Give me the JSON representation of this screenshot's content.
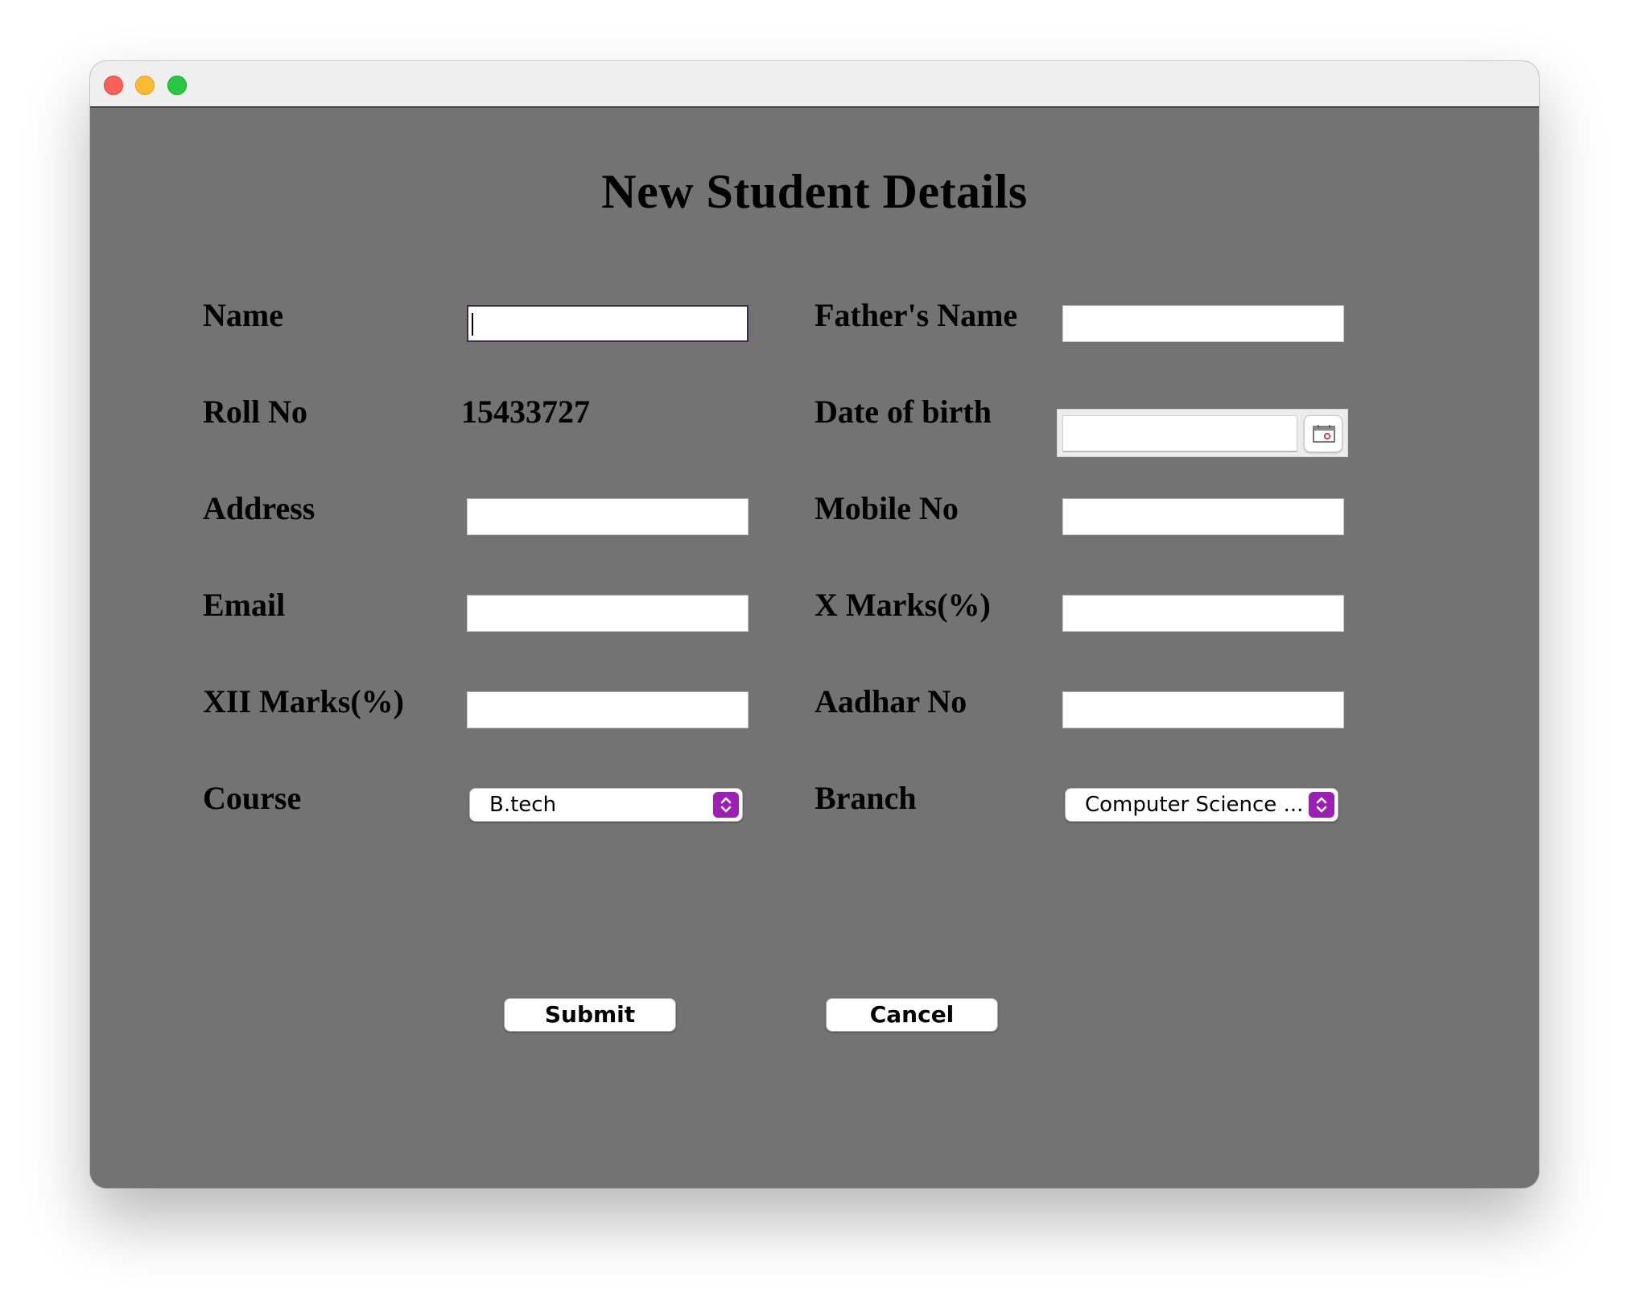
{
  "window": {
    "controls": [
      "close",
      "minimize",
      "maximize"
    ]
  },
  "form": {
    "title": "New Student Details",
    "name_label": "Name",
    "name_value": "",
    "fathers_name_label": "Father's Name",
    "fathers_name_value": "",
    "roll_no_label": "Roll No",
    "roll_no_value": "15433727",
    "dob_label": "Date of birth",
    "dob_value": "",
    "address_label": "Address",
    "address_value": "",
    "mobile_label": "Mobile No",
    "mobile_value": "",
    "email_label": "Email",
    "email_value": "",
    "x_marks_label": "X Marks(%)",
    "x_marks_value": "",
    "xii_marks_label": "XII Marks(%)",
    "xii_marks_value": "",
    "aadhar_label": "Aadhar No",
    "aadhar_value": "",
    "course_label": "Course",
    "course_selected": "B.tech",
    "branch_label": "Branch",
    "branch_selected": "Computer Science ..."
  },
  "buttons": {
    "submit": "Submit",
    "cancel": "Cancel"
  },
  "colors": {
    "background": "#737373",
    "titlebar": "#efeff0",
    "stepper_accent": "#9b1fb3"
  },
  "icons": {
    "calendar": "calendar-icon",
    "stepper": "chevron-up-down-icon"
  }
}
